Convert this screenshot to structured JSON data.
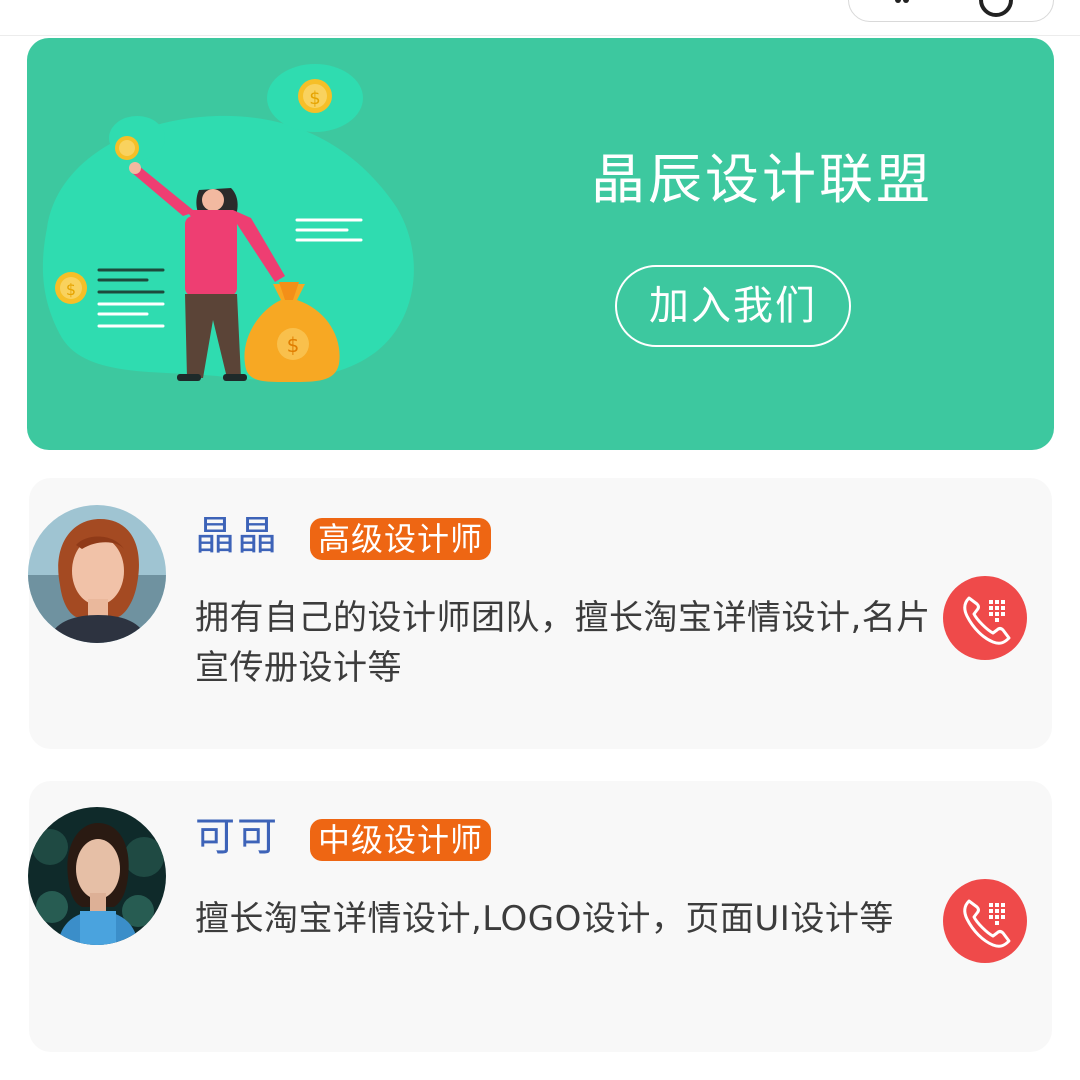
{
  "banner": {
    "title": "晶辰设计联盟",
    "join_label": "加入我们",
    "color": "#3dc89f"
  },
  "designers": [
    {
      "name": "晶晶",
      "level": "高级设计师",
      "description": "拥有自己的设计师团队，擅长淘宝详情设计,名片宣传册设计等",
      "icon": "phone-icon"
    },
    {
      "name": "可可",
      "level": "中级设计师",
      "description": "擅长淘宝详情设计,LOGO设计，页面UI设计等",
      "icon": "phone-icon"
    }
  ],
  "colors": {
    "name": "#3d63b8",
    "badge": "#ee6613",
    "call": "#ef4a4a"
  }
}
